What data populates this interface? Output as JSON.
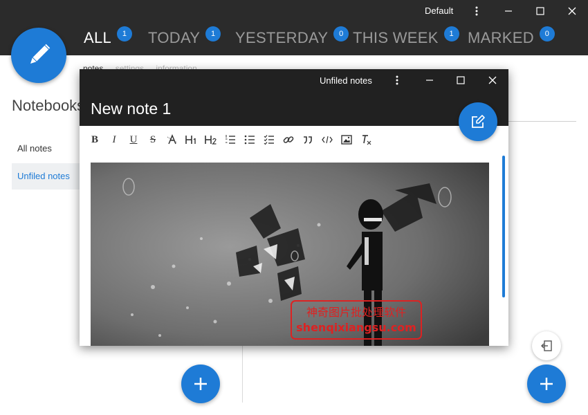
{
  "titlebar": {
    "theme_label": "Default"
  },
  "nav": {
    "tabs": [
      {
        "label": "ALL",
        "count": "1"
      },
      {
        "label": "TODAY",
        "count": "1"
      },
      {
        "label": "YESTERDAY",
        "count": "0"
      },
      {
        "label": "THIS WEEK",
        "count": "1"
      },
      {
        "label": "MARKED",
        "count": "0"
      }
    ]
  },
  "background": {
    "subtabs": [
      "notes",
      "settings",
      "information"
    ],
    "notebooks_title": "Notebooks",
    "notebooks": [
      "All notes",
      "Unfiled notes"
    ]
  },
  "note": {
    "notebook": "Unfiled notes",
    "title": "New note 1",
    "image_watermark_line1": "神奇图片批处理软件",
    "image_watermark_line2": "shenqixiangsu.com"
  },
  "colors": {
    "accent": "#1e7bd6",
    "header": "#2b2b2b",
    "note_header": "#212121"
  }
}
